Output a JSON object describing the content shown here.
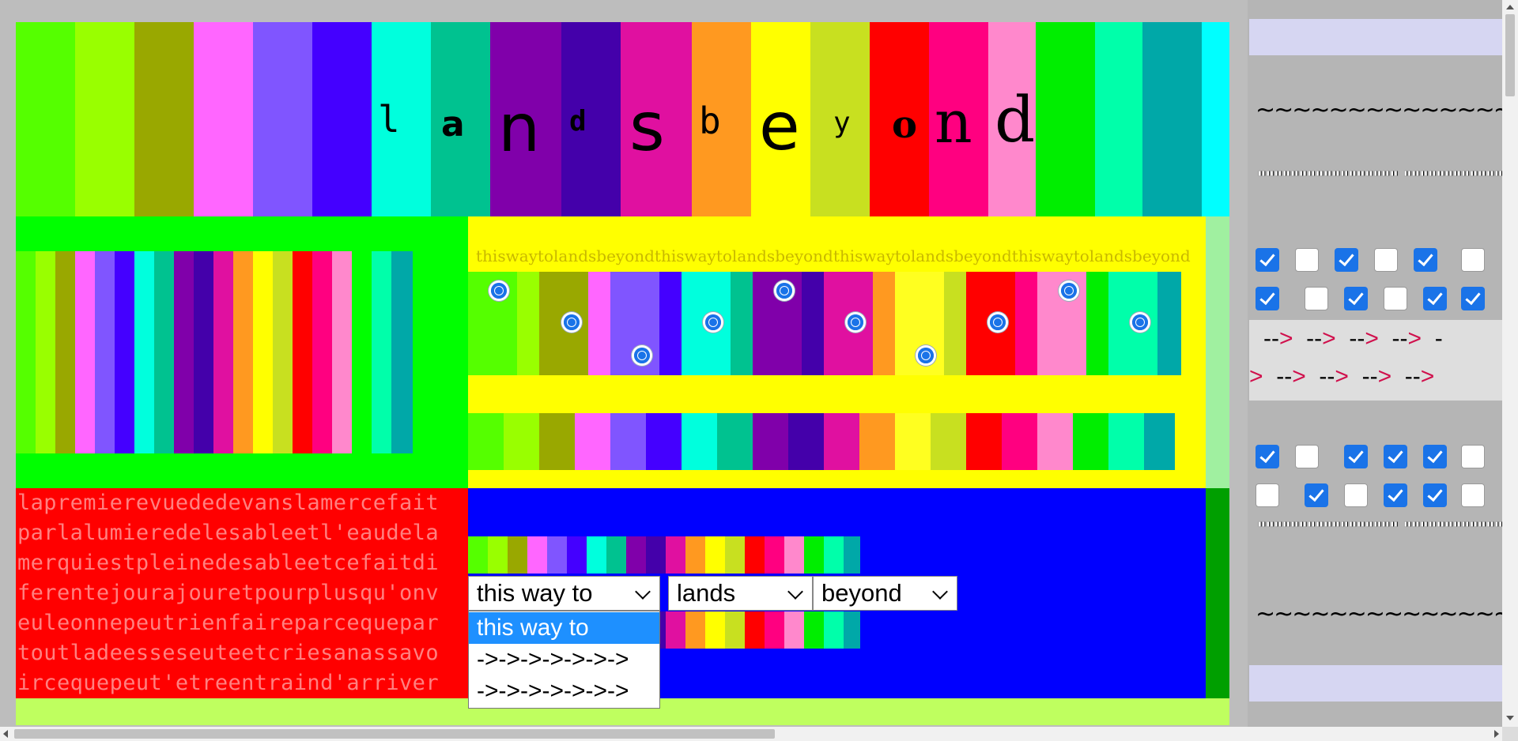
{
  "banner": {
    "word_letters": [
      "l",
      "a",
      "n",
      "d",
      "s",
      "b",
      "e",
      "y",
      "o",
      "n",
      "d"
    ]
  },
  "palette": [
    "#55ff00",
    "#99ff00",
    "#99a800",
    "#ff66ff",
    "#8055ff",
    "#4400ff",
    "#00ffdd",
    "#00c290",
    "#8000aa",
    "#4400aa",
    "#e010a0",
    "#ff9920",
    "#ffff00",
    "#c8e020",
    "#ff0000",
    "#ff0080",
    "#ff88cc",
    "#00ee00",
    "#00ffaa",
    "#00a8a8",
    "#00ffff"
  ],
  "tagline": "thiswaytolandsbeyondthiswaytolandsbeyondthiswaytolandsbeyondthiswaytolandsbeyond",
  "poem_lines": [
    "lapremierevuededevanslamercefait",
    "parlalumieredelesableetl'eaudela",
    "merquiestpleinedesableetcefaitdi",
    "ferentejourajouretpourplusqu'onv",
    "euleonnepeutrienfaireparcequepar",
    "toutladeesseseuteetcriesanassavo",
    "ircequepeut'etreentraind'arriver"
  ],
  "selects": {
    "first": {
      "value": "this way to",
      "options": [
        "this way to",
        "->->->->->->->",
        "->->->->->->->"
      ]
    },
    "second": {
      "value": "lands"
    },
    "third": {
      "value": "beyond"
    }
  },
  "sidebar": {
    "squiggle": "~~~~~~~~~~~~~~~~~~~~~~~",
    "quotes": "\"\"\"\"\"\"\"\"\"\"\"\"\"\"\"\"\" \"\"\"\"\"\"\"\"\"\"\"\"\"\"\"\"",
    "arrow_row1": [
      [
        "--",
        "d"
      ],
      [
        ">",
        "g"
      ],
      [
        "  --",
        "d"
      ],
      [
        ">",
        "g"
      ],
      [
        "  --",
        "d"
      ],
      [
        ">",
        "g"
      ],
      [
        "  --",
        "d"
      ],
      [
        ">",
        "g"
      ],
      [
        "  -",
        "d"
      ]
    ],
    "arrow_row2": [
      [
        ">",
        "g"
      ],
      [
        "  --",
        "d"
      ],
      [
        ">",
        "g"
      ],
      [
        "  --",
        "d"
      ],
      [
        ">",
        "g"
      ],
      [
        "  --",
        "d"
      ],
      [
        ">",
        "g"
      ],
      [
        "  --",
        "d"
      ],
      [
        ">",
        "g"
      ]
    ],
    "checkbox_groups": [
      [
        true,
        false,
        true,
        false,
        true,
        false,
        true
      ],
      [
        true,
        false,
        true,
        false,
        true,
        true,
        true
      ],
      [
        true,
        false,
        true,
        true,
        true,
        false,
        true
      ],
      [
        false,
        true,
        false,
        true,
        true,
        false,
        true
      ]
    ]
  }
}
